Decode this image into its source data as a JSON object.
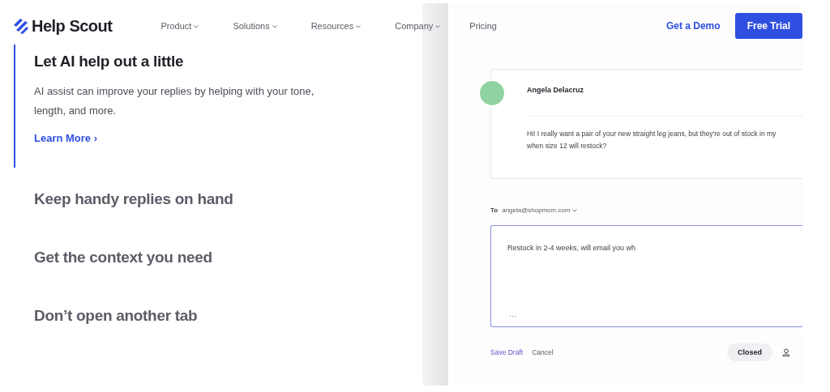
{
  "header": {
    "logo": "Help Scout",
    "nav": [
      {
        "label": "Product",
        "caret": true
      },
      {
        "label": "Solutions",
        "caret": true
      },
      {
        "label": "Resources",
        "caret": true
      },
      {
        "label": "Company",
        "caret": true
      },
      {
        "label": "Pricing",
        "caret": false
      }
    ],
    "demo_link": "Get a Demo",
    "trial_button": "Free Trial"
  },
  "features": [
    {
      "title": "Let AI help out a little",
      "selected": true,
      "body": "AI assist can improve your replies by helping with your tone, length, and more.",
      "link": "Learn More ›"
    },
    {
      "title": "Keep handy replies on hand",
      "selected": false
    },
    {
      "title": "Get the context you need",
      "selected": false
    },
    {
      "title": "Don’t open another tab",
      "selected": false
    }
  ],
  "conversation": {
    "message": {
      "sender": "Angela Delacruz",
      "text": "Hi! I really want a pair of your new straight leg jeans, but they're out of stock in my when size 12 will restock?"
    },
    "reply": {
      "to_label": "To",
      "to_address": "angela@shopmcm.com",
      "value": "Restock in 2-4 weeks, will email you wh",
      "more": "···"
    },
    "footer": {
      "save_draft": "Save Draft",
      "cancel": "Cancel",
      "status_button": "Closed"
    }
  }
}
